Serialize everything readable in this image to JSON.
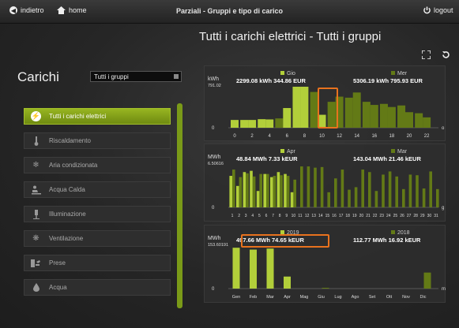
{
  "topbar": {
    "back_label": "indietro",
    "home_label": "home",
    "title": "Parziali - Gruppi e tipo di carico",
    "logout_label": "logout"
  },
  "page_title": "Tutti i carichi elettrici - Tutti i gruppi",
  "left_panel": {
    "title": "Carichi",
    "group_select_value": "Tutti i gruppi",
    "items": [
      {
        "label": "Tutti i carichi elettrici",
        "icon": "lightning-icon",
        "active": true
      },
      {
        "label": "Riscaldamento",
        "icon": "thermometer-icon",
        "active": false
      },
      {
        "label": "Aria condizionata",
        "icon": "snowflake-icon",
        "active": false
      },
      {
        "label": "Acqua Calda",
        "icon": "shower-icon",
        "active": false
      },
      {
        "label": "Illuminazione",
        "icon": "lamp-icon",
        "active": false
      },
      {
        "label": "Ventilazione",
        "icon": "fan-icon",
        "active": false
      },
      {
        "label": "Prese",
        "icon": "plug-icon",
        "active": false
      },
      {
        "label": "Acqua",
        "icon": "water-drop-icon",
        "active": false
      }
    ]
  },
  "colors": {
    "current": "#b2cf3a",
    "previous": "#637a16",
    "accent": "#8fb01d",
    "highlight": "#e8721e"
  },
  "chart_data": [
    {
      "type": "bar",
      "unit": "kWh",
      "ymax_label": "791.02",
      "ylim": [
        0,
        791.02
      ],
      "series": [
        {
          "name": "Gio",
          "summary": "2299.08 kWh 344.86 EUR"
        },
        {
          "name": "Mer",
          "summary": "5306.19 kWh 795.93 EUR"
        }
      ],
      "x_ticks": [
        "0",
        "2",
        "4",
        "6",
        "8",
        "10",
        "12",
        "14",
        "16",
        "18",
        "20",
        "22"
      ],
      "right_label": "o",
      "bars": [
        {
          "x": 0,
          "s": 0,
          "v": 150
        },
        {
          "x": 1.1,
          "s": 0,
          "v": 150
        },
        {
          "x": 2,
          "s": 0,
          "v": 150
        },
        {
          "x": 3.1,
          "s": 0,
          "v": 165
        },
        {
          "x": 4,
          "s": 0,
          "v": 160
        },
        {
          "x": 5.1,
          "s": 1,
          "v": 180
        },
        {
          "x": 6,
          "s": 0,
          "v": 380
        },
        {
          "x": 7.1,
          "s": 0,
          "v": 791
        },
        {
          "x": 8,
          "s": 0,
          "v": 791
        },
        {
          "x": 9.1,
          "s": 1,
          "v": 690
        },
        {
          "x": 10,
          "s": 0,
          "v": 250
        },
        {
          "x": 11.1,
          "s": 1,
          "v": 500
        },
        {
          "x": 12,
          "s": 1,
          "v": 600
        },
        {
          "x": 13.1,
          "s": 1,
          "v": 580
        },
        {
          "x": 14,
          "s": 1,
          "v": 680
        },
        {
          "x": 15.1,
          "s": 1,
          "v": 500
        },
        {
          "x": 16,
          "s": 1,
          "v": 440
        },
        {
          "x": 17.1,
          "s": 1,
          "v": 460
        },
        {
          "x": 18,
          "s": 1,
          "v": 400
        },
        {
          "x": 19.1,
          "s": 1,
          "v": 430
        },
        {
          "x": 20,
          "s": 1,
          "v": 300
        },
        {
          "x": 21.1,
          "s": 1,
          "v": 280
        },
        {
          "x": 22,
          "s": 1,
          "v": 200
        }
      ]
    },
    {
      "type": "bar",
      "unit": "MWh",
      "ymax_label": "6.50616",
      "ylim": [
        0,
        6.50616
      ],
      "series": [
        {
          "name": "Apr",
          "summary": "48.84 MWh 7.33 kEUR"
        },
        {
          "name": "Mar",
          "summary": "143.04 MWh 21.46 kEUR"
        }
      ],
      "x_ticks": [
        "1",
        "2",
        "3",
        "4",
        "5",
        "6",
        "7",
        "8",
        "9",
        "10",
        "11",
        "12",
        "13",
        "14",
        "15",
        "16",
        "17",
        "18",
        "19",
        "20",
        "21",
        "22",
        "23",
        "24",
        "25",
        "26",
        "27",
        "28",
        "29",
        "30",
        "31"
      ],
      "right_label": "g",
      "current": [
        5.0,
        3.4,
        5.6,
        5.8,
        2.6,
        5.3,
        4.8,
        5.6,
        5.3,
        2.4,
        0,
        0,
        0,
        0,
        0,
        0,
        0,
        0,
        0,
        0,
        0,
        0,
        0,
        0,
        0,
        0,
        0,
        0,
        0,
        0,
        0
      ],
      "previous": [
        6.0,
        4.8,
        5.4,
        4.9,
        5.3,
        5.3,
        5.0,
        5.1,
        5.0,
        4.4,
        6.5,
        6.5,
        6.3,
        6.4,
        2.4,
        4.6,
        6.0,
        2.8,
        3.2,
        6.0,
        5.6,
        2.6,
        5.2,
        5.7,
        4.9,
        2.9,
        5.2,
        5.1,
        3.0,
        5.7,
        2.9
      ]
    },
    {
      "type": "bar",
      "unit": "MWh",
      "ymax_label": "153.60191",
      "ylim": [
        0,
        153.60191
      ],
      "series": [
        {
          "name": "2019",
          "summary": "497.66 MWh 74.65 kEUR"
        },
        {
          "name": "2018",
          "summary": "112.77 MWh 16.92 kEUR"
        }
      ],
      "categories": [
        "Gen",
        "Feb",
        "Mar",
        "Apr",
        "Mag",
        "Giu",
        "Lug",
        "Ago",
        "Set",
        "Ott",
        "Nov",
        "Dic"
      ],
      "right_label": "m",
      "current": [
        153,
        146,
        150,
        45,
        0,
        0,
        0,
        0,
        0,
        0,
        0,
        0
      ],
      "previous": [
        0,
        0,
        0,
        0,
        0,
        3,
        0,
        0,
        0,
        0,
        0,
        60
      ]
    }
  ]
}
